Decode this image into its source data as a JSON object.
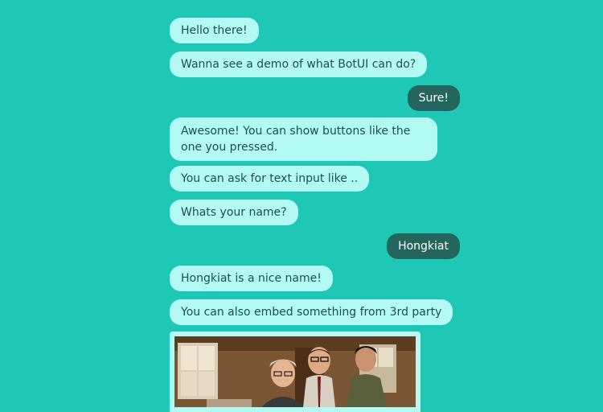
{
  "messages": [
    {
      "from": "bot",
      "text": "Hello there!"
    },
    {
      "from": "bot",
      "text": "Wanna see a demo of what BotUI can do?"
    },
    {
      "from": "human",
      "text": "Sure!"
    },
    {
      "from": "bot",
      "text": "Awesome! You can show buttons like the one you pressed."
    },
    {
      "from": "bot",
      "text": "You can ask for text input like .."
    },
    {
      "from": "bot",
      "text": "Whats your name?"
    },
    {
      "from": "human",
      "text": "Hongkiat"
    },
    {
      "from": "bot",
      "text": "Hongkiat is a nice name!"
    },
    {
      "from": "bot",
      "text": "You can also embed something from 3rd party"
    }
  ],
  "colors": {
    "background": "#1ec8b4",
    "bot_bubble": "#b3fbf2",
    "bot_text": "#1b4f4a",
    "human_bubble": "#24655d",
    "human_text": "#ffffff"
  }
}
